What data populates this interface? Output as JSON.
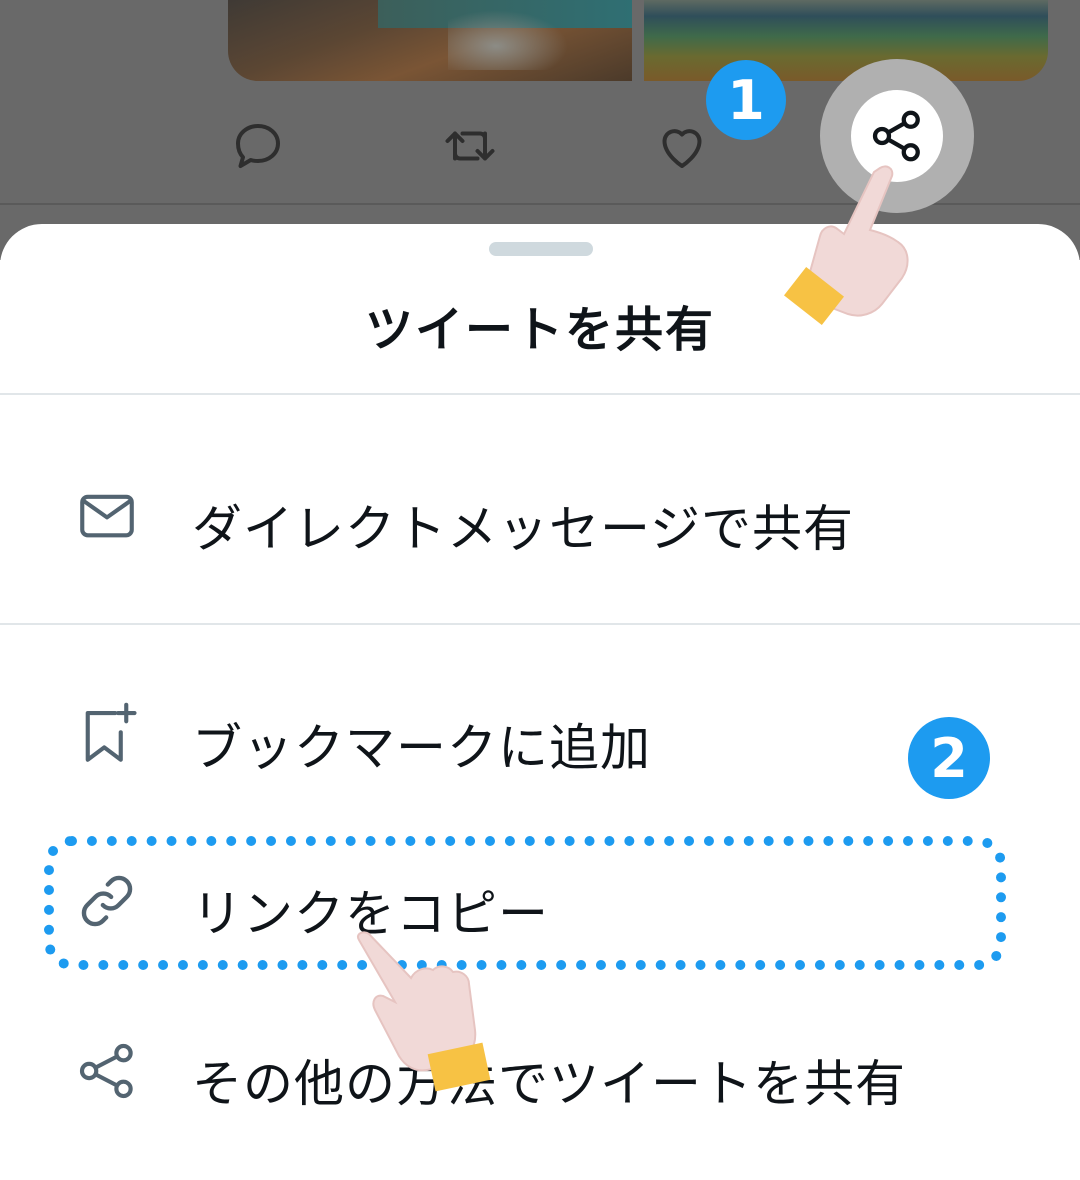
{
  "tweet": {
    "actions": [
      {
        "name": "reply-icon"
      },
      {
        "name": "retweet-icon"
      },
      {
        "name": "like-icon"
      },
      {
        "name": "share-icon"
      }
    ]
  },
  "steps": {
    "step1": "1",
    "step2": "2"
  },
  "sheet": {
    "title": "ツイートを共有",
    "items": [
      {
        "icon": "mail-icon",
        "label": "ダイレクトメッセージで共有"
      },
      {
        "icon": "bookmark-add-icon",
        "label": "ブックマークに追加"
      },
      {
        "icon": "link-icon",
        "label": "リンクをコピー"
      },
      {
        "icon": "share-icon",
        "label": "その他の方法でツイートを共有"
      }
    ]
  },
  "colors": {
    "accent": "#1d9bf0",
    "icon_gray": "#536471",
    "text": "#0f1419",
    "overlay": "#696969",
    "hand_skin": "#f1d9d7",
    "hand_cuff": "#f7c244"
  }
}
